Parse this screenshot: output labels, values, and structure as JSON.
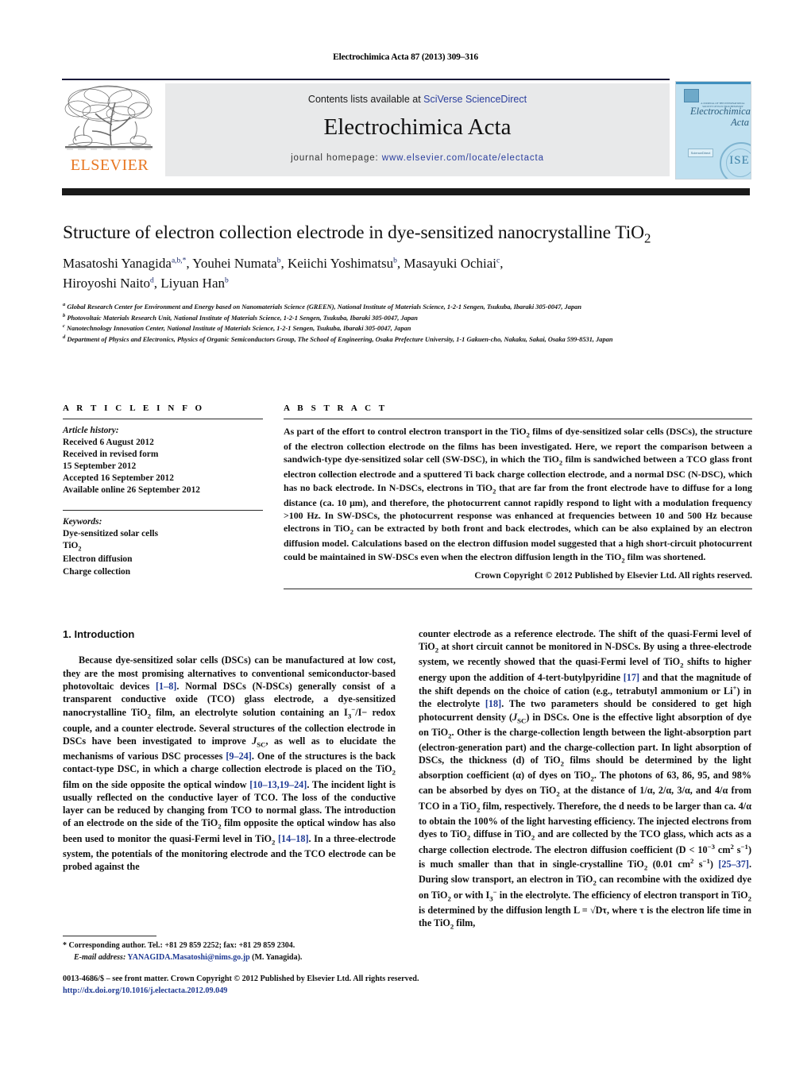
{
  "running_head": "Electrochimica Acta 87 (2013) 309–316",
  "masthead": {
    "contents_prefix": "Contents lists available at ",
    "contents_link": "SciVerse ScienceDirect",
    "journal_title": "Electrochimica Acta",
    "homepage_prefix": "journal homepage: ",
    "homepage_link": "www.elsevier.com/locate/electacta",
    "publisher_logo_text": "ELSEVIER",
    "publisher_logo_icon": "elsevier-tree-logo",
    "cover": {
      "society_line": "A JOURNAL OF THE INTERNATIONAL SOCIETY OF ELECTROCHEMISTRY",
      "title_line_1": "Electrochimica",
      "title_line_2": "Acta",
      "badge": "ScienceDirect",
      "seal_text": "ISE"
    }
  },
  "article": {
    "title_main": "Structure of electron collection electrode in dye-sensitized nanocrystalline TiO",
    "title_sub": "2",
    "authors_line_1_parts": [
      {
        "name": "Masatoshi Yanagida",
        "sup": "a,b,*"
      },
      {
        "name": "Youhei Numata",
        "sup": "b"
      },
      {
        "name": "Keiichi Yoshimatsu",
        "sup": "b"
      },
      {
        "name": "Masayuki Ochiai",
        "sup": "c"
      }
    ],
    "authors_line_2_parts": [
      {
        "name": "Hiroyoshi Naito",
        "sup": "d"
      },
      {
        "name": "Liyuan Han",
        "sup": "b"
      }
    ],
    "affiliations": [
      {
        "label": "a",
        "text": "Global Research Center for Environment and Energy based on Nanomaterials Science (GREEN), National Institute of Materials Science, 1-2-1 Sengen, Tsukuba, Ibaraki 305-0047, Japan"
      },
      {
        "label": "b",
        "text": "Photovoltaic Materials Research Unit, National Institute of Materials Science, 1-2-1 Sengen, Tsukuba, Ibaraki 305-0047, Japan"
      },
      {
        "label": "c",
        "text": "Nanotechnology Innovation Center, National Institute of Materials Science, 1-2-1 Sengen, Tsukuba, Ibaraki 305-0047, Japan"
      },
      {
        "label": "d",
        "text": "Department of Physics and Electronics, Physics of Organic Semiconductors Group, The School of Engineering, Osaka Prefecture University, 1-1 Gakuen-cho, Nakaku, Sakai, Osaka 599-8531, Japan"
      }
    ]
  },
  "article_info": {
    "heading": "A R T I C L E    I N F O",
    "history_label": "Article history:",
    "history": [
      "Received 6 August 2012",
      "Received in revised form",
      "15 September 2012",
      "Accepted 16 September 2012",
      "Available online 26 September 2012"
    ],
    "keywords_label": "Keywords:",
    "keywords": [
      "Dye-sensitized solar cells",
      "TiO2",
      "Electron diffusion",
      "Charge collection"
    ]
  },
  "abstract": {
    "heading": "A B S T R A C T",
    "text": "As part of the effort to control electron transport in the TiO2 films of dye-sensitized solar cells (DSCs), the structure of the electron collection electrode on the films has been investigated. Here, we report the comparison between a sandwich-type dye-sensitized solar cell (SW-DSC), in which the TiO2 film is sandwiched between a TCO glass front electron collection electrode and a sputtered Ti back charge collection electrode, and a normal DSC (N-DSC), which has no back electrode. In N-DSCs, electrons in TiO2 that are far from the front electrode have to diffuse for a long distance (ca. 10 μm), and therefore, the photocurrent cannot rapidly respond to light with a modulation frequency >100 Hz. In SW-DSCs, the photocurrent response was enhanced at frequencies between 10 and 500 Hz because electrons in TiO2 can be extracted by both front and back electrodes, which can be also explained by an electron diffusion model. Calculations based on the electron diffusion model suggested that a high short-circuit photocurrent could be maintained in SW-DSCs even when the electron diffusion length in the TiO2 film was shortened.",
    "copyright": "Crown Copyright © 2012 Published by Elsevier Ltd. All rights reserved."
  },
  "body": {
    "section_number_title": "1.  Introduction",
    "left_paragraph": "Because dye-sensitized solar cells (DSCs) can be manufactured at low cost, they are the most promising alternatives to conventional semiconductor-based photovoltaic devices [1–8]. Normal DSCs (N-DSCs) generally consist of a transparent conductive oxide (TCO) glass electrode, a dye-sensitized nanocrystalline TiO2 film, an electrolyte solution containing an I3−/I− redox couple, and a counter electrode. Several structures of the collection electrode in DSCs have been investigated to improve JSC, as well as to elucidate the mechanisms of various DSC processes [9–24]. One of the structures is the back contact-type DSC, in which a charge collection electrode is placed on the TiO2 film on the side opposite the optical window [10–13,19–24]. The incident light is usually reflected on the conductive layer of TCO. The loss of the conductive layer can be reduced by changing from TCO to normal glass. The introduction of an electrode on the side of the TiO2 film opposite the optical window has also been used to monitor the quasi-Fermi level in TiO2 [14–18]. In a three-electrode system, the potentials of the monitoring electrode and the TCO electrode can be probed against the",
    "right_paragraph": "counter electrode as a reference electrode. The shift of the quasi-Fermi level of TiO2 at short circuit cannot be monitored in N-DSCs. By using a three-electrode system, we recently showed that the quasi-Fermi level of TiO2 shifts to higher energy upon the addition of 4-tert-butylpyridine [17] and that the magnitude of the shift depends on the choice of cation (e.g., tetrabutyl ammonium or Li+) in the electrolyte [18]. The two parameters should be considered to get high photocurrent density (JSC) in DSCs. One is the effective light absorption of dye on TiO2. Other is the charge-collection length between the light-absorption part (electron-generation part) and the charge-collection part. In light absorption of DSCs, the thickness (d) of TiO2 films should be determined by the light absorption coefficient (α) of dyes on TiO2. The photons of 63, 86, 95, and 98% can be absorbed by dyes on TiO2 at the distance of 1/α, 2/α, 3/α, and 4/α from TCO in a TiO2 film, respectively. Therefore, the d needs to be larger than ca. 4/α to obtain the 100% of the light harvesting efficiency. The injected electrons from dyes to TiO2 diffuse in TiO2 and are collected by the TCO glass, which acts as a charge collection electrode. The electron diffusion coefficient (D < 10−3 cm2 s−1) is much smaller than that in single-crystalline TiO2 (0.01 cm2 s−1) [25–37]. During slow transport, an electron in TiO2 can recombine with the oxidized dye on TiO2 or with I3− in the electrolyte. The efficiency of electron transport in TiO2 is determined by the diffusion length L = √Dτ, where τ is the electron life time in the TiO2 film,"
  },
  "footnote": {
    "corresponding": "* Corresponding author. Tel.: +81 29 859 2252; fax: +81 29 859 2304.",
    "email_label": "E-mail address:",
    "email": "YANAGIDA.Masatoshi@nims.go.jp",
    "email_suffix": "(M. Yanagida)."
  },
  "footer": {
    "issn_line": "0013-4686/$ – see front matter. Crown Copyright © 2012 Published by Elsevier Ltd. All rights reserved.",
    "doi": "http://dx.doi.org/10.1016/j.electacta.2012.09.049"
  },
  "colors": {
    "link_blue": "#2b3f9e",
    "ref_blue": "#1f3a93",
    "elsevier_orange": "#E87722",
    "panel_grey": "#e8e9ea",
    "cover_blue": "#bfe0f0",
    "bar_black": "#1a1a1a"
  }
}
